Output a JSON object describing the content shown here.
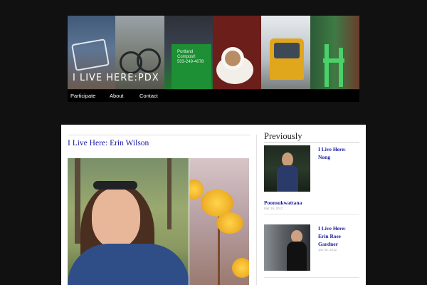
{
  "site": {
    "title": "I LIVE HERE:PDX"
  },
  "header_photos": {
    "cart_text": "Portland\nCompost!\n503-249-4078"
  },
  "nav": {
    "items": [
      {
        "label": "Participate"
      },
      {
        "label": "About"
      },
      {
        "label": "Contact"
      }
    ]
  },
  "post": {
    "title": "I Live Here: Erin Wilson"
  },
  "sidebar": {
    "title": "Previously",
    "entries": [
      {
        "title_line1": "I Live Here:",
        "title_line2": "Nong",
        "title_line3": "Poonsukwattana",
        "date": "Mar 19, 2012"
      },
      {
        "title_line1": "I Live Here:",
        "title_line2": "Erin Rose",
        "title_line3": "Gardner",
        "date": "Jan 30, 2012"
      }
    ]
  },
  "colors": {
    "page_bg": "#111111",
    "link": "#1a1aa0",
    "nav_bg": "#000000"
  }
}
